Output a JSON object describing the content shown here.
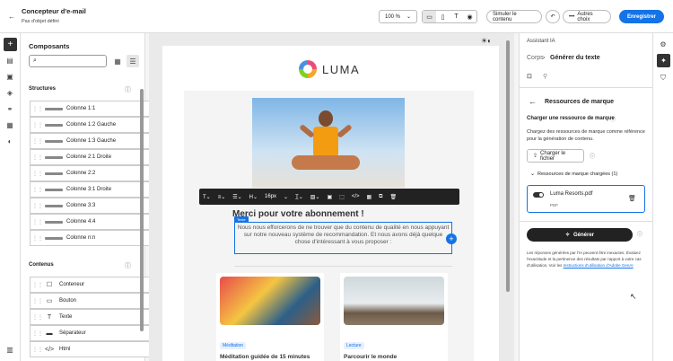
{
  "header": {
    "title": "Concepteur d'e-mail",
    "subtitle": "Pas d'objet défini",
    "zoom": "100 %",
    "simulate": "Simuler le contenu",
    "other_choices": "Autres choix",
    "save": "Enregistrer"
  },
  "left": {
    "title": "Composants",
    "search_placeholder": "",
    "structures_title": "Structures",
    "structures": [
      "Colonne 1:1",
      "Colonne 1:2 Gauche",
      "Colonne 1:3 Gauche",
      "Colonne 2:1 Droite",
      "Colonne 2:2",
      "Colonne 3:1 Droite",
      "Colonne 3:3",
      "Colonne 4:4",
      "Colonne n:n"
    ],
    "content_title": "Contenus",
    "contents": [
      "Conteneur",
      "Bouton",
      "Texte",
      "Séparateur",
      "Html"
    ]
  },
  "email": {
    "brand": "LUMA",
    "headline": "Merci pour votre abonnement !",
    "body": "Nous nous efforcerons de ne trouver que du contenu de qualité en nous appuyant sur notre nouveau système de recommandation. Et nous avons déjà quelque chose d'intéressant à vous proposer :",
    "text_tag": "Texte",
    "font_size": "16px",
    "card1_tag": "Méditation",
    "card1_title": "Méditation guidée de 15 minutes",
    "card2_tag": "Lecture",
    "card2_title": "Parcourir le monde"
  },
  "right": {
    "assistant": "Assistant IA",
    "crumb_root": "Corps",
    "crumb_current": "Générer du texte",
    "section_title": "Ressources de marque",
    "upload_heading": "Charger une ressource de marque",
    "upload_desc": "Chargez des ressources de marque comme référence pour la génération de contenu.",
    "upload_btn": "Charger le fichier",
    "loaded_label": "Ressources de marque chargées (1)",
    "file_name": "Luma Resorts.pdf",
    "file_type": "PDF",
    "generate": "Générer",
    "disclaimer": "Les réponses générées par l'IA peuvent être inexactes. Évaluez l'exactitude et la pertinence des résultats par rapport à votre cas d'utilisation. Voir les",
    "disclaimer_link": "Instructions d'utilisation d'Adobe GenAI"
  },
  "colors": {
    "accent": "#1473e6",
    "dark": "#222222"
  }
}
